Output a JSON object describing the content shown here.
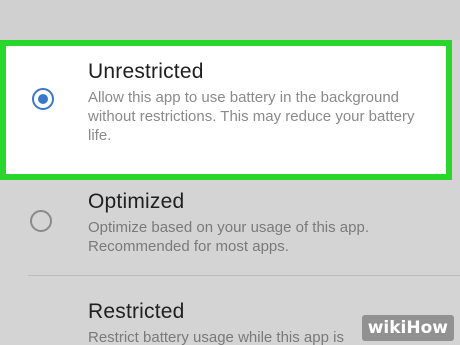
{
  "options": [
    {
      "title": "Unrestricted",
      "description": "Allow this app to use battery in the background without restrictions. This may reduce your battery life.",
      "selected": true
    },
    {
      "title": "Optimized",
      "description": "Optimize based on your usage of this app. Recommended for most apps.",
      "selected": false
    },
    {
      "title": "Restricted",
      "description": "Restrict battery usage while this app is",
      "selected": false
    }
  ],
  "colors": {
    "highlight": "#29d62a",
    "radio_active": "#3a76c9"
  },
  "watermark": {
    "text": "wikiHow"
  }
}
